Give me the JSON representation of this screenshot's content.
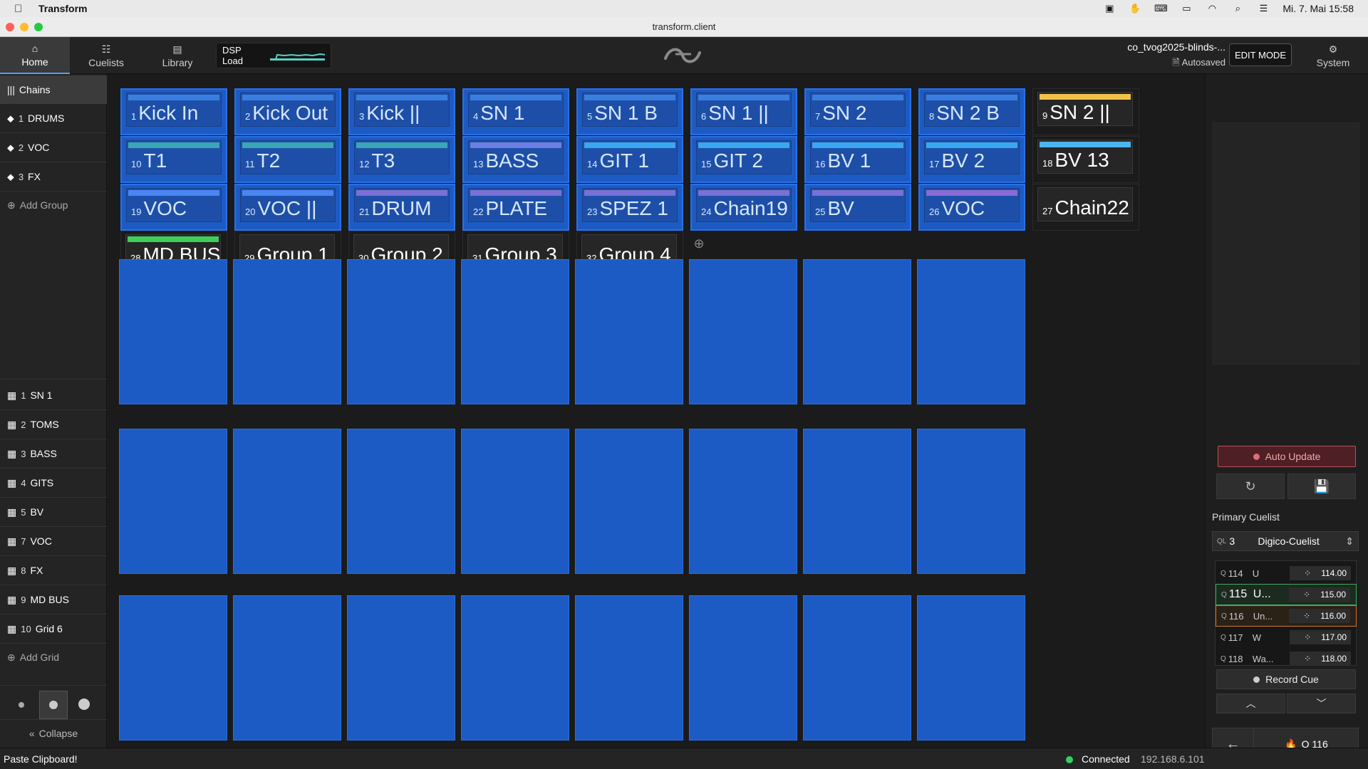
{
  "mac_menubar": {
    "app_name": "Transform",
    "datetime": "Mi. 7. Mai  15:58"
  },
  "window": {
    "title": "transform.client"
  },
  "nav": {
    "home": "Home",
    "cuelists": "Cuelists",
    "library": "Library",
    "system": "System"
  },
  "dsp": {
    "label": "DSP Load"
  },
  "project": {
    "name": "co_tvog2025-blinds-...",
    "autosaved": "Autosaved",
    "edit_mode": "EDIT MODE"
  },
  "sidebar": {
    "chains_header": "Chains",
    "groups": [
      {
        "num": "1",
        "label": "DRUMS"
      },
      {
        "num": "2",
        "label": "VOC"
      },
      {
        "num": "3",
        "label": "FX"
      }
    ],
    "add_group": "Add Group",
    "grids": [
      {
        "num": "1",
        "label": "SN 1"
      },
      {
        "num": "2",
        "label": "TOMS"
      },
      {
        "num": "3",
        "label": "BASS"
      },
      {
        "num": "4",
        "label": "GITS"
      },
      {
        "num": "5",
        "label": "BV"
      },
      {
        "num": "7",
        "label": "VOC"
      },
      {
        "num": "8",
        "label": "FX"
      },
      {
        "num": "9",
        "label": "MD BUS"
      },
      {
        "num": "10",
        "label": "Grid 6"
      }
    ],
    "add_grid": "Add Grid",
    "collapse": "Collapse"
  },
  "chains": [
    {
      "num": "1",
      "name": "Kick In",
      "color": "#3a7fe0",
      "selected": true
    },
    {
      "num": "2",
      "name": "Kick Out",
      "color": "#3a7fe0",
      "selected": true
    },
    {
      "num": "3",
      "name": "Kick ||",
      "color": "#3a7fe0",
      "selected": true
    },
    {
      "num": "4",
      "name": "SN 1",
      "color": "#3a7fe0",
      "selected": true
    },
    {
      "num": "5",
      "name": "SN 1 B",
      "color": "#3a7fe0",
      "selected": true
    },
    {
      "num": "6",
      "name": "SN 1 ||",
      "color": "#3a7fe0",
      "selected": true
    },
    {
      "num": "7",
      "name": "SN 2",
      "color": "#3a7fe0",
      "selected": true
    },
    {
      "num": "8",
      "name": "SN 2 B",
      "color": "#3a7fe0",
      "selected": true
    },
    {
      "num": "9",
      "name": "SN 2 ||",
      "color": "#f0c24a",
      "selected": false
    },
    {
      "num": "10",
      "name": "T1",
      "color": "#3aa6b6",
      "selected": true
    },
    {
      "num": "11",
      "name": "T2",
      "color": "#3aa6b6",
      "selected": true
    },
    {
      "num": "12",
      "name": "T3",
      "color": "#3aa6b6",
      "selected": true
    },
    {
      "num": "13",
      "name": "BASS",
      "color": "#6d7fe0",
      "selected": true
    },
    {
      "num": "14",
      "name": "GIT 1",
      "color": "#3aa8f0",
      "selected": true
    },
    {
      "num": "15",
      "name": "GIT 2",
      "color": "#3aa8f0",
      "selected": true
    },
    {
      "num": "16",
      "name": "BV 1",
      "color": "#3aa8f0",
      "selected": true
    },
    {
      "num": "17",
      "name": "BV 2",
      "color": "#3aa8f0",
      "selected": true
    },
    {
      "num": "18",
      "name": "BV 13",
      "color": "#4bb5ee",
      "selected": false
    },
    {
      "num": "19",
      "name": "VOC",
      "color": "#4a86f0",
      "selected": true
    },
    {
      "num": "20",
      "name": "VOC ||",
      "color": "#4a86f0",
      "selected": true
    },
    {
      "num": "21",
      "name": "DRUM",
      "color": "#7a70d6",
      "selected": true
    },
    {
      "num": "22",
      "name": "PLATE",
      "color": "#7a70d6",
      "selected": true
    },
    {
      "num": "23",
      "name": "SPEZ 1",
      "color": "#7a70d6",
      "selected": true
    },
    {
      "num": "24",
      "name": "Chain19",
      "color": "#7a70d6",
      "selected": true
    },
    {
      "num": "25",
      "name": "BV",
      "color": "#7a70d6",
      "selected": true
    },
    {
      "num": "26",
      "name": "VOC",
      "color": "#8a6ad6",
      "selected": true
    },
    {
      "num": "27",
      "name": "Chain22",
      "color": "",
      "selected": false
    },
    {
      "num": "28",
      "name": "MD BUS",
      "color": "#3ecf5a",
      "selected": false
    },
    {
      "num": "29",
      "name": "Group 1",
      "color": "",
      "selected": false
    },
    {
      "num": "30",
      "name": "Group 2",
      "color": "",
      "selected": false
    },
    {
      "num": "31",
      "name": "Group 3",
      "color": "",
      "selected": false
    },
    {
      "num": "32",
      "name": "Group 4",
      "color": "",
      "selected": false
    }
  ],
  "right_panel": {
    "auto_update": "Auto Update",
    "primary_cuelist_label": "Primary Cuelist",
    "cuelist_ql": "QL",
    "cuelist_num": "3",
    "cuelist_name": "Digico-Cuelist",
    "cues": [
      {
        "q": "Q",
        "num": "114",
        "name": "U",
        "time": "114.00",
        "state": "normal"
      },
      {
        "q": "Q",
        "num": "115",
        "name": "U...",
        "time": "115.00",
        "state": "active"
      },
      {
        "q": "Q",
        "num": "116",
        "name": "Un...",
        "time": "116.00",
        "state": "next"
      },
      {
        "q": "Q",
        "num": "117",
        "name": "W",
        "time": "117.00",
        "state": "normal"
      },
      {
        "q": "Q",
        "num": "118",
        "name": "Wa...",
        "time": "118.00",
        "state": "normal"
      }
    ],
    "record_cue": "Record Cue",
    "go_cue": "Q 116"
  },
  "status": {
    "message": "Paste Clipboard!",
    "connection": "Connected",
    "ip": "192.168.6.101"
  }
}
